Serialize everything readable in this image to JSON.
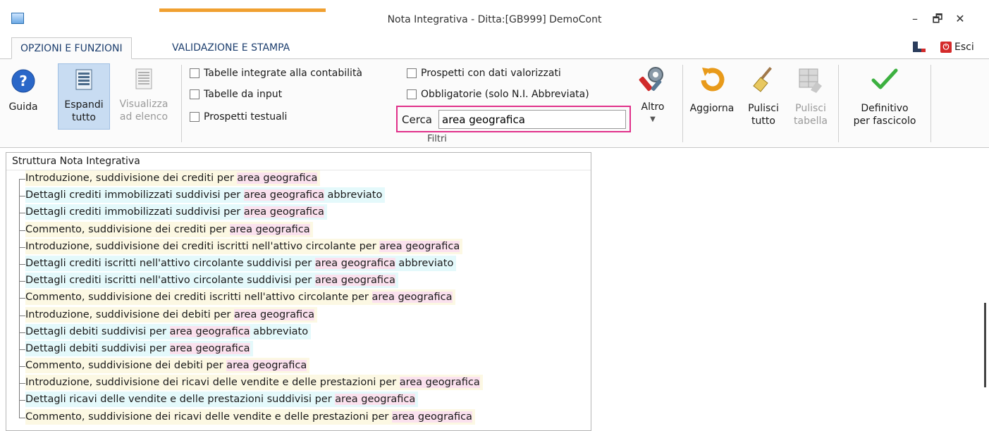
{
  "window": {
    "title": "Nota Integrativa - Ditta:[GB999] DemoCont",
    "minimize": "–",
    "restore": "🗗",
    "close": "✕"
  },
  "tabs": [
    {
      "label": "OPZIONI E FUNZIONI",
      "active": true
    },
    {
      "label": "VALIDAZIONE E STAMPA",
      "active": false
    }
  ],
  "exit_label": "Esci",
  "ribbon": {
    "guida": "Guida",
    "espandi": [
      "Espandi",
      "tutto"
    ],
    "visualizza": [
      "Visualizza",
      "ad elenco"
    ],
    "checkboxes": {
      "tabelle_integrate": "Tabelle integrate alla contabilità",
      "tabelle_input": "Tabelle da input",
      "prospetti_testuali": "Prospetti testuali",
      "prospetti_valorizzati": "Prospetti con dati valorizzati",
      "obbligatorie": "Obbligatorie (solo N.I. Abbreviata)"
    },
    "search_label": "Cerca",
    "search_value": "area geografica",
    "group_label": "Filtri",
    "altro": "Altro",
    "aggiorna": "Aggiorna",
    "pulisci_tutto": [
      "Pulisci",
      "tutto"
    ],
    "pulisci_tabella": [
      "Pulisci",
      "tabella"
    ],
    "definitivo": [
      "Definitivo",
      "per fascicolo"
    ]
  },
  "tree": {
    "header": "Struttura Nota Integrativa",
    "highlight": "area geografica",
    "rows": [
      {
        "pre": "Introduzione, suddivisione dei crediti per ",
        "post": "",
        "style": "a"
      },
      {
        "pre": "Dettagli crediti immobilizzati suddivisi per ",
        "post": " abbreviato",
        "style": "b"
      },
      {
        "pre": "Dettagli crediti immobilizzati suddivisi per ",
        "post": "",
        "style": "b"
      },
      {
        "pre": "Commento, suddivisione dei crediti per ",
        "post": "",
        "style": "a"
      },
      {
        "pre": "Introduzione, suddivisione dei crediti iscritti nell'attivo circolante per ",
        "post": "",
        "style": "a"
      },
      {
        "pre": "Dettagli crediti iscritti nell'attivo circolante suddivisi per ",
        "post": " abbreviato",
        "style": "b"
      },
      {
        "pre": "Dettagli crediti iscritti nell'attivo circolante suddivisi per ",
        "post": "",
        "style": "b"
      },
      {
        "pre": "Commento, suddivisione dei crediti iscritti nell'attivo circolante per ",
        "post": "",
        "style": "a"
      },
      {
        "pre": "Introduzione, suddivisione dei debiti per ",
        "post": "",
        "style": "a"
      },
      {
        "pre": "Dettagli debiti suddivisi per ",
        "post": " abbreviato",
        "style": "b"
      },
      {
        "pre": "Dettagli debiti suddivisi per ",
        "post": "",
        "style": "b"
      },
      {
        "pre": "Commento, suddivisione dei debiti per ",
        "post": "",
        "style": "a"
      },
      {
        "pre": "Introduzione, suddivisione dei ricavi delle vendite e delle prestazioni per ",
        "post": "",
        "style": "a"
      },
      {
        "pre": "Dettagli ricavi delle vendite e delle prestazioni suddivisi per ",
        "post": "",
        "style": "b"
      },
      {
        "pre": "Commento, suddivisione dei ricavi delle vendite e delle prestazioni per ",
        "post": "",
        "style": "a"
      }
    ]
  }
}
